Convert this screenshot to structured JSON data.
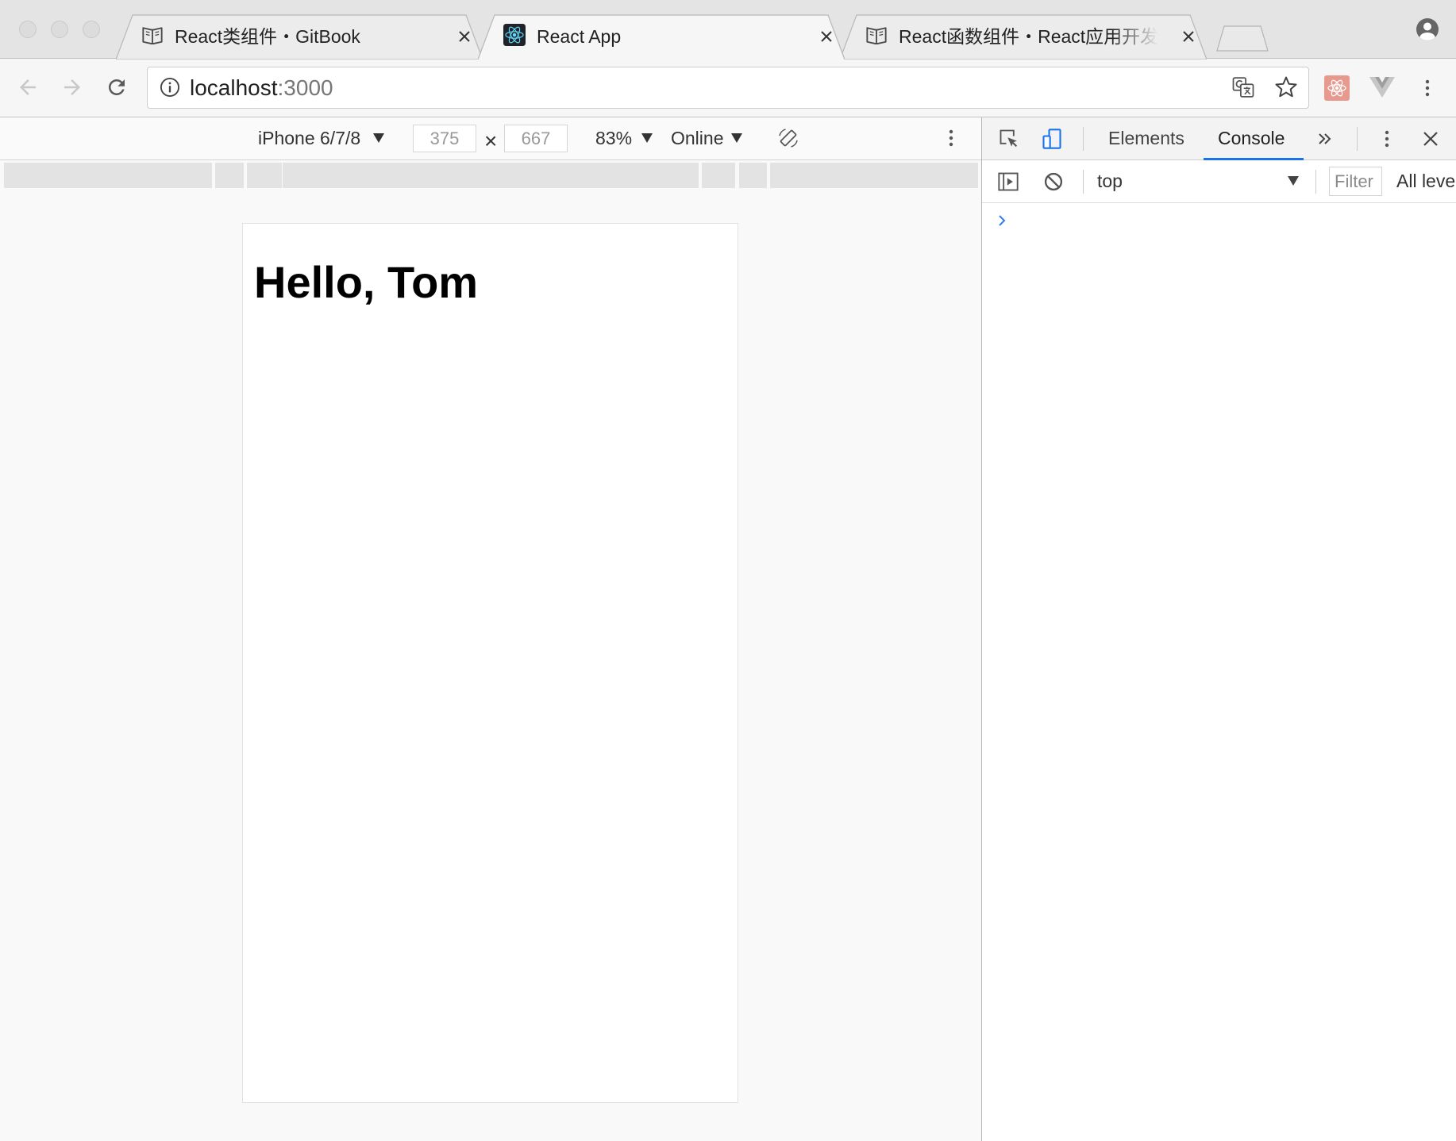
{
  "window": {
    "tabs": [
      {
        "label": "React类组件・GitBook",
        "icon": "book-icon",
        "active": false
      },
      {
        "label": "React App",
        "icon": "react-icon",
        "active": true
      },
      {
        "label": "React函数组件・React应用开发",
        "icon": "book-icon",
        "active": false
      }
    ]
  },
  "toolbar": {
    "url_host": "localhost",
    "url_port": ":3000",
    "extensions": [
      "react-devtools-icon",
      "vue-devtools-icon"
    ]
  },
  "device_toolbar": {
    "device": "iPhone 6/7/8",
    "width": "375",
    "dimension_separator": "×",
    "height": "667",
    "zoom": "83%",
    "throttling": "Online"
  },
  "devtools": {
    "tabs": [
      {
        "label": "Elements",
        "active": false
      },
      {
        "label": "Console",
        "active": true
      }
    ],
    "console": {
      "context": "top",
      "filter_placeholder": "Filter",
      "levels": "All leve"
    }
  },
  "page": {
    "heading": "Hello, Tom"
  },
  "colors": {
    "accent": "#1a73e8",
    "react_cyan": "#61dafb",
    "console_prompt": "#367cf1",
    "react_extension": "#e8998e"
  }
}
